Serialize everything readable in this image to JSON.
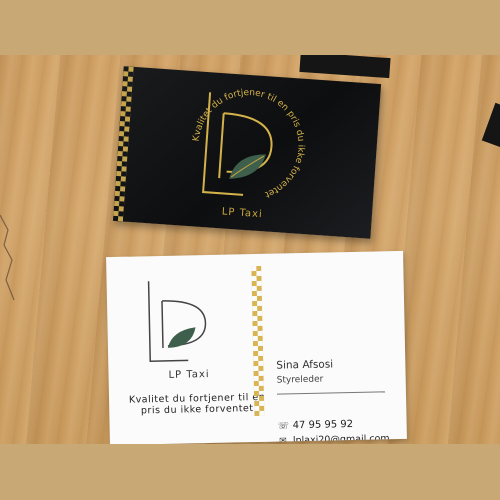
{
  "scene": {
    "colors": {
      "frame": "#c8a874",
      "wood": "#cf9f62",
      "card_black": "#111214",
      "card_white": "#fbfbfb",
      "gold": "#d8b452",
      "leaf": "#3e5f4c"
    }
  },
  "black_card": {
    "tagline_arc": "Kvalitet du fortjener til en pris du ikke forventet",
    "brand": "LP Taxi"
  },
  "white_card": {
    "brand": "LP Taxi",
    "tagline": "Kvalitet du fortjener til en pris du ikke forventet",
    "name": "Sina Afsosi",
    "role": "Styreleder",
    "phone": "47 95 95 92",
    "email": "lplaxi20@gmail.com",
    "phone_icon": "phone-icon",
    "email_icon": "envelope-icon"
  }
}
